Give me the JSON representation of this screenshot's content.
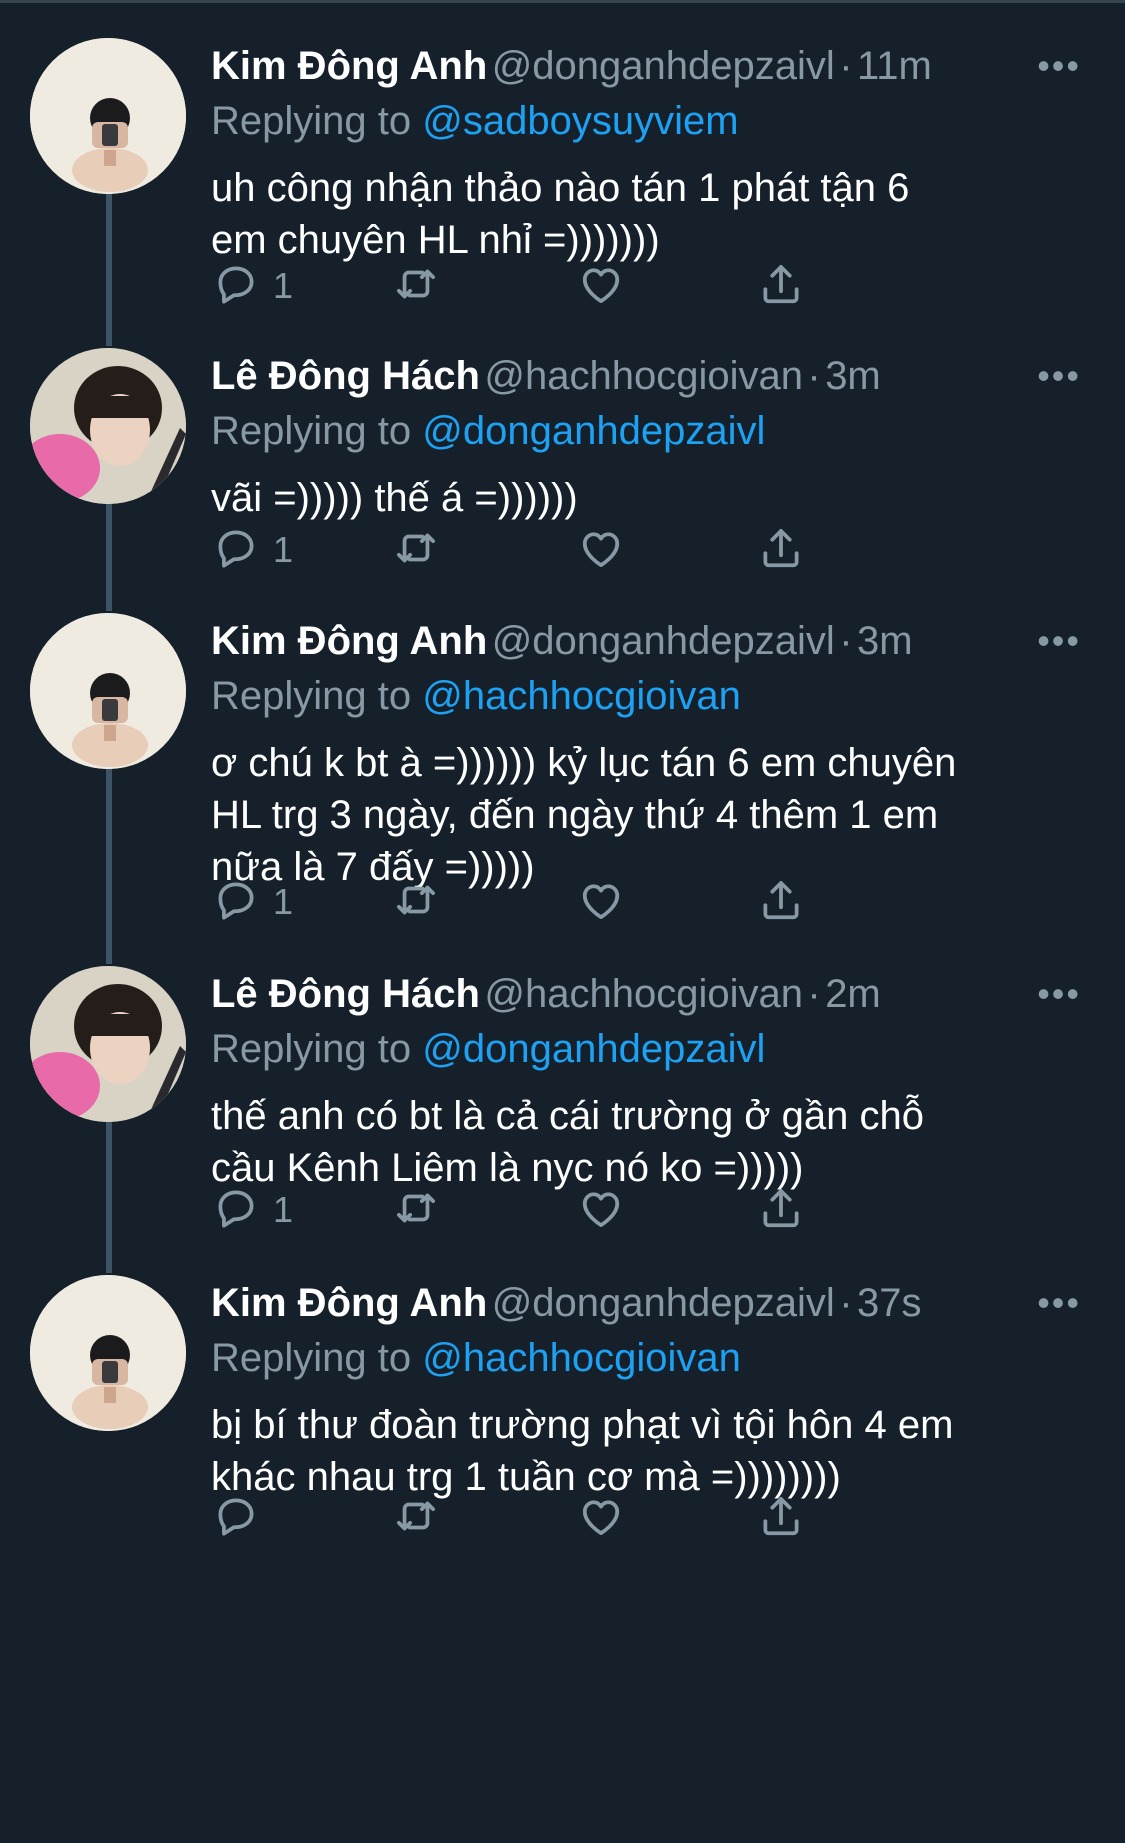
{
  "tweets": [
    {
      "name": "Kim Đông Anh",
      "handle": "@donganhdepzaivl",
      "time": "11m",
      "replying_label": "Replying to",
      "replying_to": "@sadboysuyviem",
      "lines": [
        "uh công nhận thảo nào tán 1 phát tận 6",
        "em chuyên HL nhỉ =)))))))"
      ],
      "reply_count": "1",
      "avatar": "kim"
    },
    {
      "name": "Lê Đông Hách",
      "handle": "@hachhocgioivan",
      "time": "3m",
      "replying_label": "Replying to",
      "replying_to": "@donganhdepzaivl",
      "lines": [
        "vãi =))))) thế á =))))))"
      ],
      "reply_count": "1",
      "avatar": "le"
    },
    {
      "name": "Kim Đông Anh",
      "handle": "@donganhdepzaivl",
      "time": "3m",
      "replying_label": "Replying to",
      "replying_to": "@hachhocgioivan",
      "lines": [
        "ơ chú k bt à =)))))) kỷ lục tán 6 em chuyên",
        "HL trg 3 ngày, đến ngày thứ 4 thêm 1 em",
        "nữa là 7 đấy =)))))"
      ],
      "reply_count": "1",
      "avatar": "kim"
    },
    {
      "name": "Lê Đông Hách",
      "handle": "@hachhocgioivan",
      "time": "2m",
      "replying_label": "Replying to",
      "replying_to": "@donganhdepzaivl",
      "lines": [
        "thế anh có bt là cả cái trường ở gần chỗ",
        "cầu Kênh Liêm là nyc nó ko =)))))"
      ],
      "reply_count": "1",
      "avatar": "le"
    },
    {
      "name": "Kim Đông Anh",
      "handle": "@donganhdepzaivl",
      "time": "37s",
      "replying_label": "Replying to",
      "replying_to": "@hachhocgioivan",
      "lines": [
        "bị bí thư đoàn trường phạt vì tội hôn 4 em",
        "khác nhau trg 1 tuần cơ mà =))))))))"
      ],
      "reply_count": "",
      "avatar": "kim"
    }
  ],
  "separator": "·",
  "more_glyph": "•••",
  "icons": {
    "reply": "reply-icon",
    "retweet": "retweet-icon",
    "like": "heart-icon",
    "share": "share-icon"
  },
  "colors": {
    "background": "#15202b",
    "text": "#ffffff",
    "secondary": "#8899a6",
    "accent": "#1da1f2",
    "connector": "#3d5466"
  }
}
